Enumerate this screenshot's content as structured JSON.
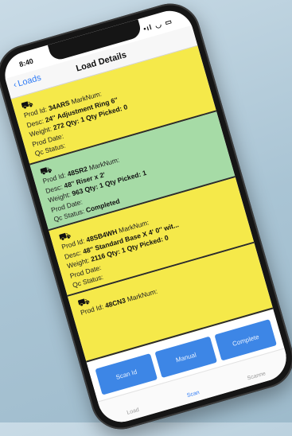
{
  "status_bar": {
    "time": "8:40",
    "signal": "•ıl",
    "wifi": "◡",
    "battery": "▭"
  },
  "navbar": {
    "back_label": "Loads",
    "title": "Load Details"
  },
  "cards": [
    {
      "color": "yellow",
      "prod_id_label": "Prod Id:",
      "prod_id": "34ARS",
      "marknum_label": "MarkNum:",
      "desc_label": "Desc:",
      "desc": "24'' Adjustment Ring 6''",
      "weight_label": "Weight:",
      "weight": "272",
      "qty": "Qty: 1 Qty Picked: 0",
      "prod_date_label": "Prod Date:",
      "qc_label": "Qc Status:",
      "qc_status": ""
    },
    {
      "color": "green",
      "prod_id_label": "Prod Id:",
      "prod_id": "48SR2",
      "marknum_label": "MarkNum:",
      "desc_label": "Desc:",
      "desc": "48'' Riser x 2'",
      "weight_label": "Weight:",
      "weight": "963",
      "qty": "Qty: 1 Qty Picked: 1",
      "prod_date_label": "Prod Date:",
      "qc_label": "Qc Status:",
      "qc_status": "Completed"
    },
    {
      "color": "yellow",
      "prod_id_label": "Prod Id:",
      "prod_id": "48SB4WH",
      "marknum_label": "MarkNum:",
      "desc_label": "Desc:",
      "desc": "48'' Standard Base X 4' 0'' wit...",
      "weight_label": "Weight:",
      "weight": "2116",
      "qty": "Qty: 1 Qty Picked: 0",
      "prod_date_label": "Prod Date:",
      "qc_label": "Qc Status:",
      "qc_status": ""
    },
    {
      "color": "yellow",
      "prod_id_label": "Prod Id:",
      "prod_id": "48CN3",
      "marknum_label": "MarkNum:"
    }
  ],
  "actions": {
    "scan": "Scan Id",
    "manual": "Manual",
    "complete": "Complete"
  },
  "tabs": [
    {
      "label": "Load"
    },
    {
      "label": "Scan"
    },
    {
      "label": "Scanne"
    }
  ],
  "colors": {
    "yellow_card": "#f5e94a",
    "green_card": "#a6dba6",
    "accent": "#2f7bf5",
    "button": "#3d86e6"
  }
}
